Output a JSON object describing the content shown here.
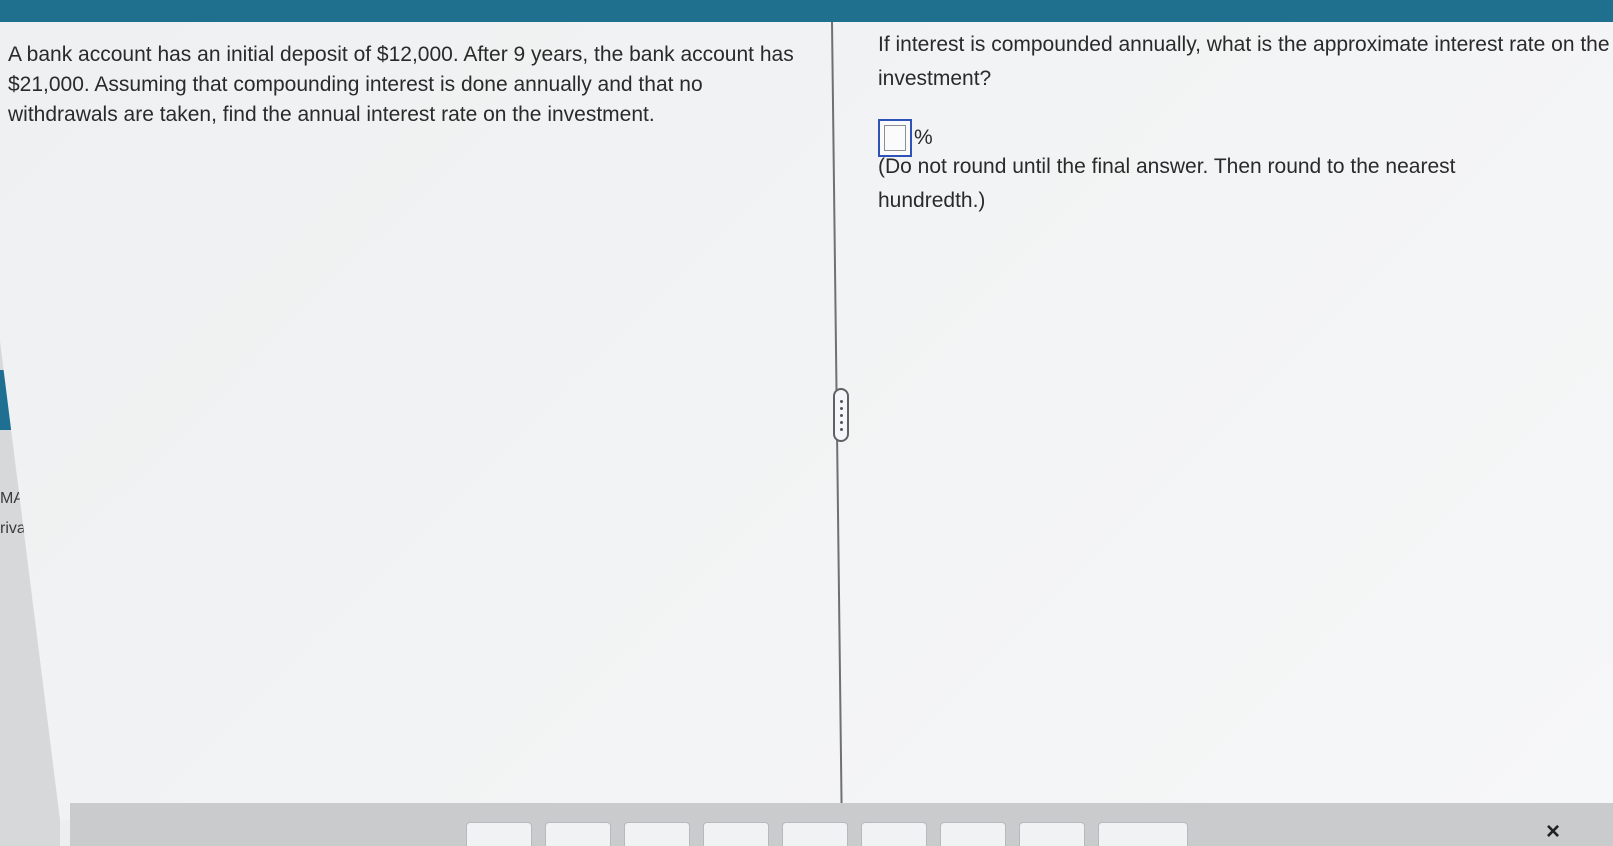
{
  "problem": {
    "text": "A bank account has an initial deposit of $12,000. After 9 years, the bank account has $21,000. Assuming that compounding interest is done annually and that no withdrawals are taken, find the annual interest rate on the investment."
  },
  "question": {
    "prompt": "If interest is compounded annually, what is the approximate interest rate on the investment?",
    "answer_value": "",
    "unit": "%",
    "instruction": "(Do not round until the final answer. Then round to the nearest hundredth.)"
  },
  "left_strip": {
    "text_1": "MA",
    "text_2": "riva"
  },
  "toolbar": {
    "buttons": [
      "",
      "",
      "",
      "",
      "",
      "",
      "",
      "",
      ""
    ]
  },
  "close_label": "×",
  "colors": {
    "top_bar": "#1f6f8f",
    "input_border": "#2e52b8"
  }
}
